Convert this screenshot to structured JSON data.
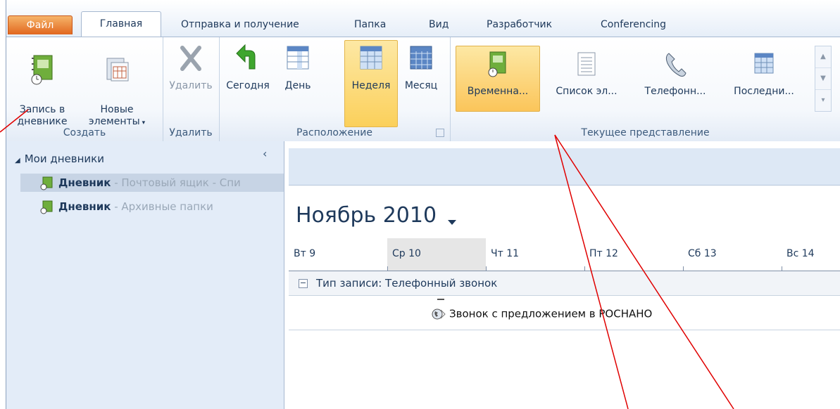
{
  "tabs": [
    {
      "label": "Файл"
    },
    {
      "label": "Главная"
    },
    {
      "label": "Отправка и получение"
    },
    {
      "label": "Папка"
    },
    {
      "label": "Вид"
    },
    {
      "label": "Разработчик"
    },
    {
      "label": "Conferencing"
    }
  ],
  "ribbon": {
    "create": {
      "label": "Создать",
      "journal_entry": "Запись в\nдневнике",
      "new_items": "Новые\nэлементы"
    },
    "delete": {
      "label": "Удалить",
      "delete_button": "Удалить"
    },
    "arrange": {
      "label": "Расположение",
      "today": "Сегодня",
      "day": "День",
      "week": "Неделя",
      "month": "Месяц"
    },
    "current_view": {
      "label": "Текущее представление",
      "items": [
        "Временна...",
        "Список эл...",
        "Телефонн...",
        "Последни..."
      ]
    }
  },
  "nav": {
    "header": "Мои дневники",
    "items": [
      {
        "name": "Дневник",
        "sub": " - Почтовый ящик - Спи"
      },
      {
        "name": "Дневник",
        "sub": " - Архивные папки"
      }
    ]
  },
  "calendar": {
    "month": "Ноябрь 2010",
    "days": [
      "Вт 9",
      "Ср 10",
      "Чт 11",
      "Пт 12",
      "Сб 13",
      "Вс 14"
    ],
    "group": "Тип записи: Телефонный звонок",
    "entry": "Звонок с предложением в РОСНАНО"
  },
  "annotation_color": "#e00000"
}
